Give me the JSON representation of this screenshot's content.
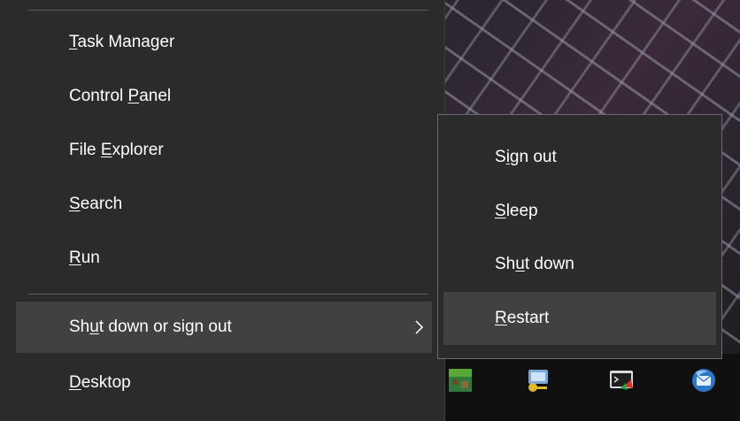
{
  "context_menu": {
    "items": [
      {
        "id": "task-manager",
        "pre": "",
        "key": "T",
        "post": "ask Manager"
      },
      {
        "id": "control-panel",
        "pre": "Control ",
        "key": "P",
        "post": "anel"
      },
      {
        "id": "file-explorer",
        "pre": "File ",
        "key": "E",
        "post": "xplorer"
      },
      {
        "id": "search",
        "pre": "",
        "key": "S",
        "post": "earch"
      },
      {
        "id": "run",
        "pre": "",
        "key": "R",
        "post": "un"
      },
      {
        "id": "shutdown-or-signout",
        "pre": "Sh",
        "key": "u",
        "post": "t down or sign out"
      },
      {
        "id": "desktop",
        "pre": "",
        "key": "D",
        "post": "esktop"
      }
    ]
  },
  "submenu": {
    "items": [
      {
        "id": "sign-out",
        "pre": "S",
        "key": "i",
        "post": "gn out"
      },
      {
        "id": "sleep",
        "pre": "",
        "key": "S",
        "post": "leep"
      },
      {
        "id": "shut-down",
        "pre": "Sh",
        "key": "u",
        "post": "t down"
      },
      {
        "id": "restart",
        "pre": "",
        "key": "R",
        "post": "estart"
      }
    ]
  },
  "taskbar": {
    "icons": [
      "minecraft-icon",
      "keys-icon",
      "terminal-icon",
      "thunderbird-icon"
    ]
  },
  "colors": {
    "menu_bg": "#2b2b2b",
    "highlight": "#414141",
    "separator": "#5a5a5a",
    "submenu_border": "#6a6a6a",
    "text": "#ffffff"
  }
}
